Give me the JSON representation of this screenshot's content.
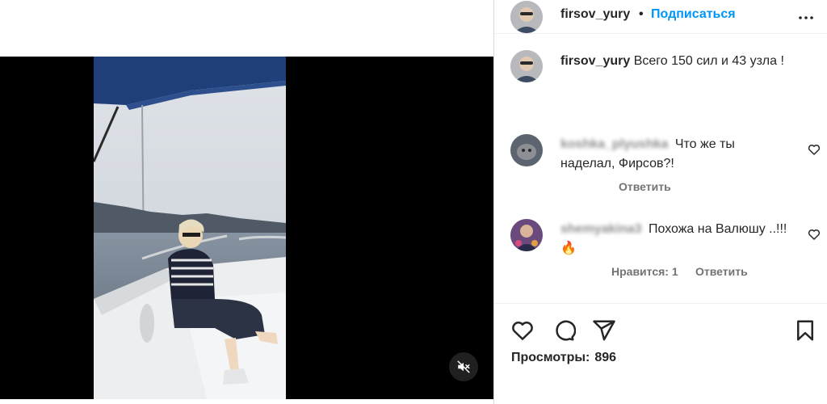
{
  "post": {
    "author": "firsov_yury",
    "separator": "•",
    "follow_label": "Подписаться",
    "more_icon": "more-horizontal-icon",
    "caption_text": "Всего 150 сил и 43 узла !"
  },
  "comments": [
    {
      "username": "koshka_plyushka",
      "text": "Что же ты наделал, Фирсов?!",
      "reply_label": "Ответить"
    },
    {
      "username": "shemyakina3",
      "text": "Похожа на Валюшу ..!!!🔥",
      "likes_label": "Нравится: 1",
      "reply_label": "Ответить"
    }
  ],
  "actions": {
    "icons": [
      "heart-icon",
      "comment-icon",
      "share-icon",
      "bookmark-icon"
    ],
    "views_label": "Просмотры:",
    "views_count": "896"
  },
  "video": {
    "mute_icon": "speaker-muted-icon"
  },
  "colors": {
    "follow": "#0095f6",
    "text": "#262626",
    "secondary": "#737373",
    "media_bg": "#000000"
  }
}
